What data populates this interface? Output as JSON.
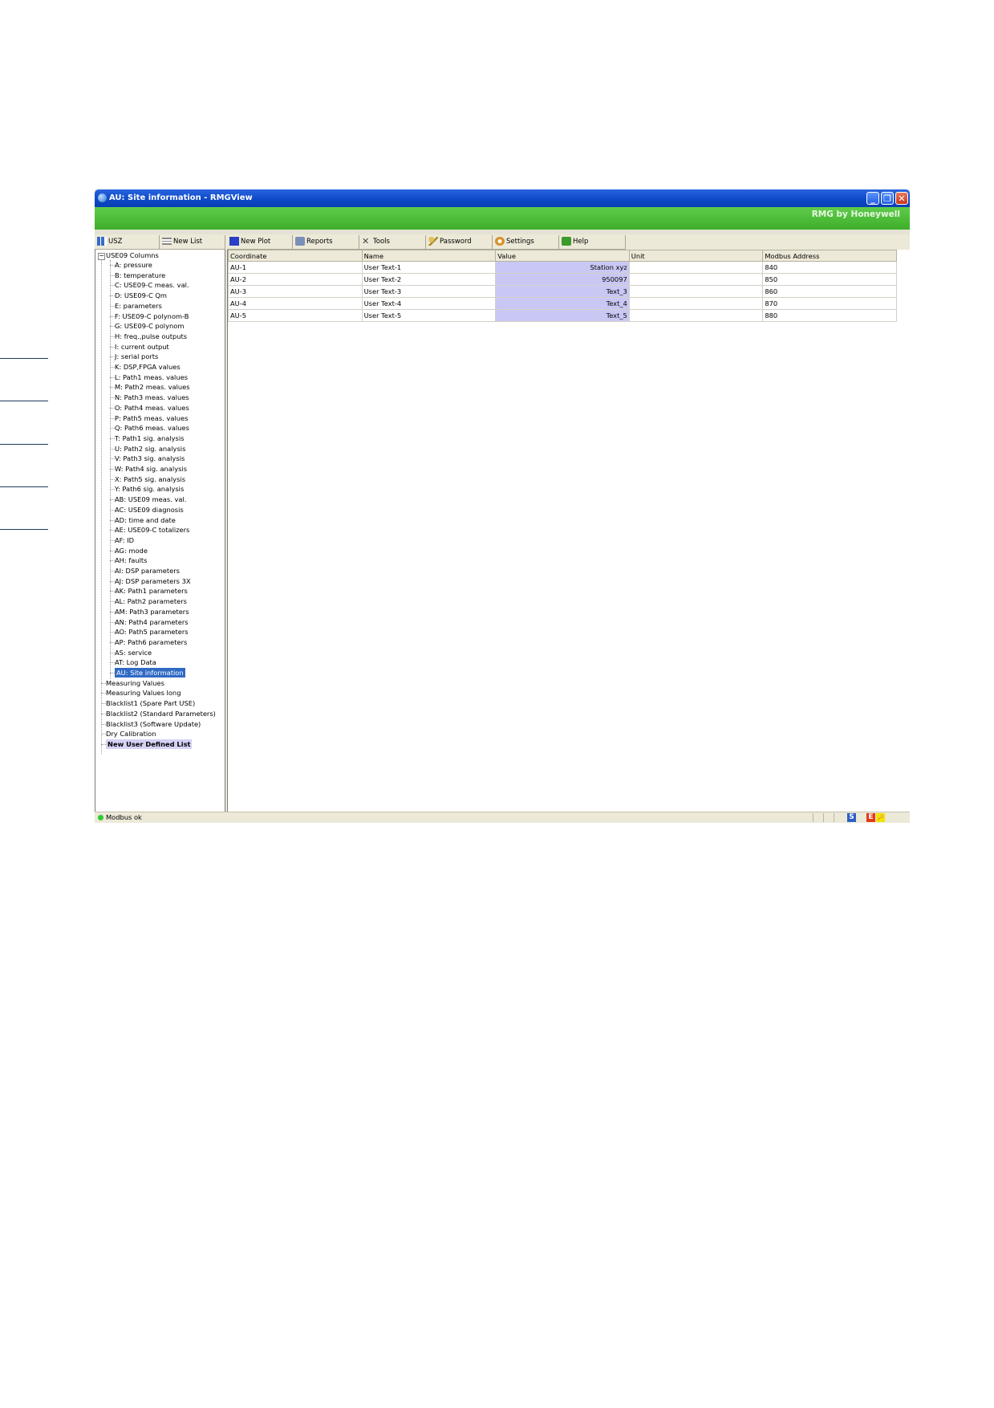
{
  "window": {
    "title": "AU: Site information - RMGView",
    "brand": "RMG by Honeywell",
    "min_glyph": "_",
    "max_glyph": "❐",
    "close_glyph": "✕"
  },
  "toolbar": {
    "usz": "USZ",
    "new_list": "New List",
    "new_plot": "New Plot",
    "reports": "Reports",
    "tools": "Tools",
    "password": "Password",
    "settings": "Settings",
    "help": "Help"
  },
  "tree": {
    "root": "USE09 Columns",
    "expander": "−",
    "children": [
      "A: pressure",
      "B: temperature",
      "C: USE09-C meas. val.",
      "D: USE09-C Qm",
      "E: parameters",
      "F: USE09-C polynom-B",
      "G: USE09-C polynom",
      "H: freq.,pulse outputs",
      "I: current output",
      "J: serial ports",
      "K: DSP,FPGA values",
      "L: Path1 meas. values",
      "M: Path2 meas. values",
      "N: Path3 meas. values",
      "O: Path4 meas. values",
      "P: Path5 meas. values",
      "Q: Path6 meas. values",
      "T: Path1 sig. analysis",
      "U: Path2 sig. analysis",
      "V: Path3 sig. analysis",
      "W: Path4 sig. analysis",
      "X: Path5 sig. analysis",
      "Y: Path6 sig. analysis",
      "AB: USE09 meas. val.",
      "AC: USE09 diagnosis",
      "AD: time and date",
      "AE: USE09-C totalizers",
      "AF: ID",
      "AG: mode",
      "AH: faults",
      "AI: DSP parameters",
      "AJ: DSP parameters 3X",
      "AK: Path1 parameters",
      "AL: Path2 parameters",
      "AM: Path3 parameters",
      "AN: Path4 parameters",
      "AO: Path5 parameters",
      "AP: Path6 parameters",
      "AS: service",
      "AT: Log Data",
      "AU: Site information"
    ],
    "siblings": [
      "Measuring Values",
      "Measuring Values long",
      "Blacklist1 (Spare Part USE)",
      "Blacklist2 (Standard Parameters)",
      "Blacklist3 (Software Update)",
      "Dry Calibration",
      "New User Defined List"
    ],
    "selected": "AU: Site information"
  },
  "grid": {
    "columns": [
      "Coordinate",
      "Name",
      "Value",
      "Unit",
      "Modbus Address"
    ],
    "rows": [
      [
        "AU-1",
        "User Text-1",
        "Station xyz",
        "",
        "840"
      ],
      [
        "AU-2",
        "User Text-2",
        "950097",
        "",
        "850"
      ],
      [
        "AU-3",
        "User Text-3",
        "Text_3",
        "",
        "860"
      ],
      [
        "AU-4",
        "User Text-4",
        "Text_4",
        "",
        "870"
      ],
      [
        "AU-5",
        "User Text-5",
        "Text_5",
        "",
        "880"
      ]
    ]
  },
  "status": {
    "text": "Modbus ok",
    "icons": {
      "s": "S",
      "e": "E",
      "key": "🔑"
    }
  },
  "colors": {
    "titlebar": "#0b48c6",
    "brandbar": "#3eae2a",
    "selection": "#316ac5",
    "value_cell": "#c9c8f5",
    "status_ok": "#2ecc2e"
  }
}
